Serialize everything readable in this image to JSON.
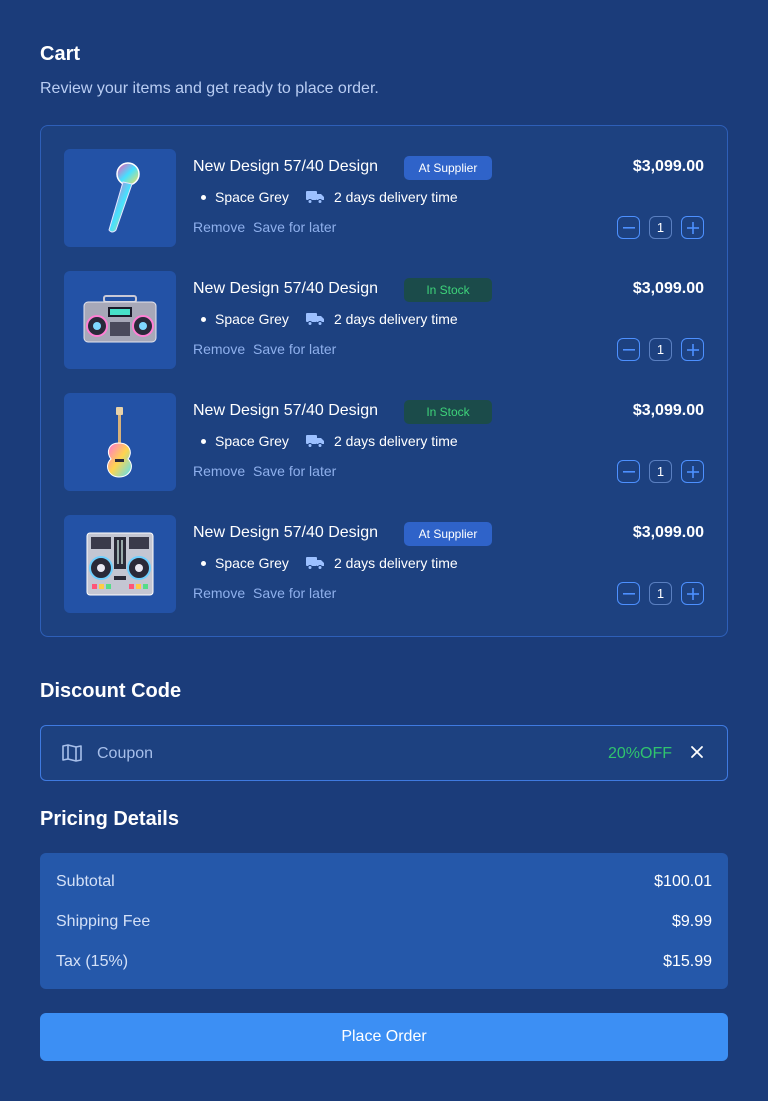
{
  "cart": {
    "title": "Cart",
    "subtitle": "Review your items and get ready to place order."
  },
  "items": [
    {
      "name": "New Design 57/40 Design",
      "badge": "At Supplier",
      "badge_type": "supplier",
      "variant": "Space Grey",
      "delivery": "2 days delivery time",
      "remove": "Remove",
      "save": "Save for later",
      "price": "$3,099.00",
      "qty": "1",
      "image": "microphone"
    },
    {
      "name": "New Design 57/40 Design",
      "badge": "In Stock",
      "badge_type": "stock",
      "variant": "Space Grey",
      "delivery": "2 days delivery time",
      "remove": "Remove",
      "save": "Save for later",
      "price": "$3,099.00",
      "qty": "1",
      "image": "boombox"
    },
    {
      "name": "New Design 57/40 Design",
      "badge": "In Stock",
      "badge_type": "stock",
      "variant": "Space Grey",
      "delivery": "2 days delivery time",
      "remove": "Remove",
      "save": "Save for later",
      "price": "$3,099.00",
      "qty": "1",
      "image": "guitar"
    },
    {
      "name": "New Design 57/40 Design",
      "badge": "At Supplier",
      "badge_type": "supplier",
      "variant": "Space Grey",
      "delivery": "2 days delivery time",
      "remove": "Remove",
      "save": "Save for later",
      "price": "$3,099.00",
      "qty": "1",
      "image": "dj-controller"
    }
  ],
  "discount": {
    "title": "Discount Code",
    "placeholder": "Coupon",
    "value": "20%OFF"
  },
  "pricing": {
    "title": "Pricing Details",
    "rows": [
      {
        "label": "Subtotal",
        "value": "$100.01"
      },
      {
        "label": "Shipping Fee",
        "value": "$9.99"
      },
      {
        "label": "Tax (15%)",
        "value": "$15.99"
      }
    ]
  },
  "order_button": "Place Order",
  "colors": {
    "background": "#1b3c7a",
    "accent": "#3c8ff4",
    "in_stock": "#3ed37a",
    "discount": "#30c46e"
  }
}
